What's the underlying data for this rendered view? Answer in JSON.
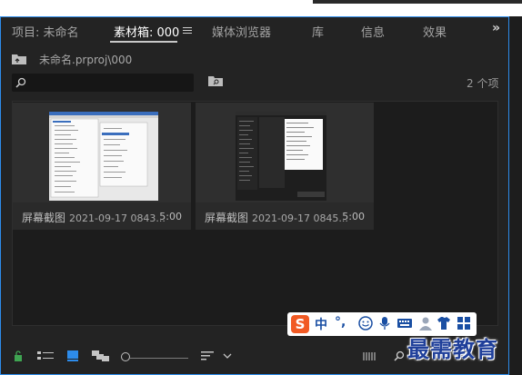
{
  "tabs": [
    {
      "label": "项目: 未命名"
    },
    {
      "label": "素材箱: 000"
    },
    {
      "label": "媒体浏览器"
    },
    {
      "label": "库"
    },
    {
      "label": "信息"
    },
    {
      "label": "效果"
    }
  ],
  "more_label": "»",
  "path": "未命名.prproj\\000",
  "search": {
    "value": ""
  },
  "item_count": "2 个项",
  "items": [
    {
      "name": "屏幕截图",
      "date": "2021-09-17 0843...",
      "duration": "5:00"
    },
    {
      "name": "屏幕截图",
      "date": "2021-09-17 0845...",
      "duration": "5:00"
    }
  ],
  "ime": {
    "logo": "S",
    "mode": "中",
    "punct": "°,"
  },
  "watermark": "最需教育",
  "colors": {
    "accent": "#2d8ceb",
    "lock_green": "#3fa552",
    "ime_orange": "#f15a24",
    "ime_blue": "#1a4fa3"
  }
}
